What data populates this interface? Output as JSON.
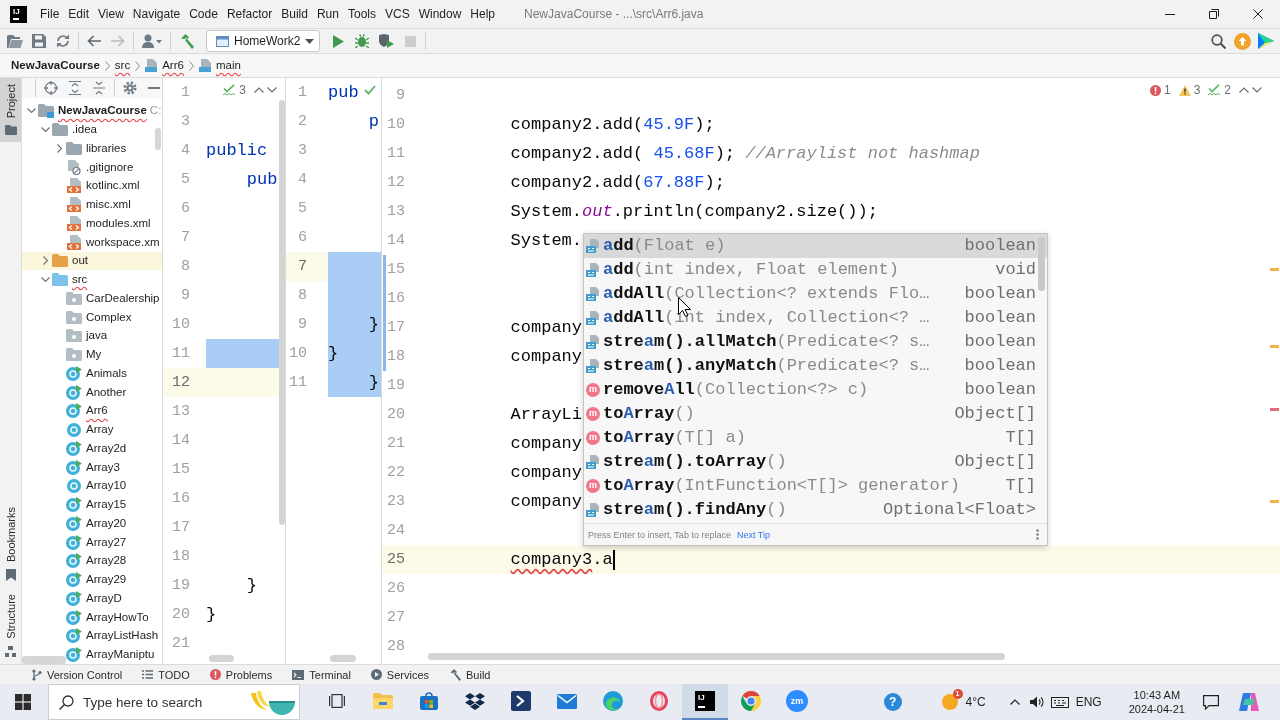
{
  "window": {
    "logo": "IJ",
    "menus": [
      "File",
      "Edit",
      "View",
      "Navigate",
      "Code",
      "Refactor",
      "Build",
      "Run",
      "Tools",
      "VCS",
      "Window",
      "Help"
    ],
    "title": "NewJavaCourse - ...\\src\\Arr6.java"
  },
  "toolbar": {
    "run_config": "HomeWork2",
    "stop_disabled": true
  },
  "breadcrumbs": [
    {
      "label": "NewJavaCourse",
      "kind": "project",
      "error": false
    },
    {
      "label": "src",
      "kind": "folder",
      "error": true
    },
    {
      "label": "Arr6",
      "kind": "class",
      "error": true
    },
    {
      "label": "main",
      "kind": "method",
      "error": true
    }
  ],
  "tool_strip": {
    "top": [
      {
        "label": "Project",
        "kind": "project",
        "selected": true
      }
    ],
    "bottom": [
      {
        "label": "Bookmarks",
        "kind": "bookmarks",
        "selected": false
      },
      {
        "label": "Structure",
        "kind": "structure",
        "selected": false
      }
    ]
  },
  "project_tree": [
    {
      "label": "NewJavaCourse",
      "kind": "project",
      "path": "C:",
      "error": true,
      "expanded": true,
      "children": [
        {
          "label": ".idea",
          "kind": "folder",
          "error": false,
          "expanded": true,
          "children": [
            {
              "label": "libraries",
              "kind": "folder",
              "error": false,
              "expanded": false
            },
            {
              "label": ".gitignore",
              "kind": "ignore-file",
              "error": false
            },
            {
              "label": "kotlinc.xml",
              "kind": "xml-file",
              "error": false
            },
            {
              "label": "misc.xml",
              "kind": "xml-file",
              "error": false
            },
            {
              "label": "modules.xml",
              "kind": "xml-file",
              "error": false
            },
            {
              "label": "workspace.xm",
              "kind": "xml-file",
              "error": false
            }
          ]
        },
        {
          "label": "out",
          "kind": "excluded-folder",
          "error": false,
          "expanded": false
        },
        {
          "label": "src",
          "kind": "source-folder",
          "error": true,
          "expanded": true,
          "children": [
            {
              "label": "CarDealership",
              "kind": "package",
              "error": false
            },
            {
              "label": "Complex",
              "kind": "package",
              "error": false
            },
            {
              "label": "java",
              "kind": "package",
              "error": false
            },
            {
              "label": "My",
              "kind": "package",
              "error": false
            },
            {
              "label": "Animals",
              "kind": "main-class",
              "error": false
            },
            {
              "label": "Another",
              "kind": "main-class",
              "error": false
            },
            {
              "label": "Arr6",
              "kind": "main-class",
              "error": true
            },
            {
              "label": "Array",
              "kind": "class",
              "error": false
            },
            {
              "label": "Array2d",
              "kind": "main-class",
              "error": false
            },
            {
              "label": "Array3",
              "kind": "main-class",
              "error": false
            },
            {
              "label": "Array10",
              "kind": "class",
              "error": false
            },
            {
              "label": "Array15",
              "kind": "main-class",
              "error": false
            },
            {
              "label": "Array20",
              "kind": "main-class",
              "error": false
            },
            {
              "label": "Array27",
              "kind": "main-class",
              "error": false
            },
            {
              "label": "Array28",
              "kind": "main-class",
              "error": false
            },
            {
              "label": "Array29",
              "kind": "main-class",
              "error": false
            },
            {
              "label": "ArrayD",
              "kind": "main-class",
              "error": false
            },
            {
              "label": "ArrayHowTo",
              "kind": "main-class",
              "error": false
            },
            {
              "label": "ArrayListHash",
              "kind": "main-class",
              "error": false
            },
            {
              "label": "ArrayManiptu",
              "kind": "main-class",
              "error": false
            }
          ]
        }
      ]
    }
  ],
  "editor_panes": [
    {
      "focused": false,
      "inspections": [
        {
          "kind": "typo",
          "count": "3"
        }
      ],
      "lines": [
        {
          "number": "1",
          "selected": false,
          "current": false
        },
        {
          "number": "3",
          "selected": false,
          "current": false
        },
        {
          "number": "4",
          "selected": false,
          "current": false,
          "tokens": [
            {
              "text": "public",
              "kind": "keyword"
            }
          ]
        },
        {
          "number": "5",
          "selected": false,
          "current": false,
          "tokens": [
            {
              "text": "    pub",
              "kind": "keyword"
            }
          ]
        },
        {
          "number": "6",
          "selected": false,
          "current": false
        },
        {
          "number": "7",
          "selected": false,
          "current": false
        },
        {
          "number": "8",
          "selected": false,
          "current": false
        },
        {
          "number": "9",
          "selected": false,
          "current": false
        },
        {
          "number": "10",
          "selected": false,
          "current": false
        },
        {
          "number": "11",
          "selected": true,
          "current": false
        },
        {
          "number": "12",
          "selected": false,
          "current": true
        },
        {
          "number": "13",
          "selected": false,
          "current": false
        },
        {
          "number": "14",
          "selected": false,
          "current": false
        },
        {
          "number": "15",
          "selected": false,
          "current": false
        },
        {
          "number": "16",
          "selected": false,
          "current": false
        },
        {
          "number": "17",
          "selected": false,
          "current": false
        },
        {
          "number": "18",
          "selected": false,
          "current": false
        },
        {
          "number": "19",
          "selected": false,
          "current": false,
          "tokens": [
            {
              "text": "    }",
              "kind": "plain"
            }
          ]
        },
        {
          "number": "20",
          "selected": false,
          "current": false,
          "tokens": [
            {
              "text": "}",
              "kind": "plain"
            }
          ]
        },
        {
          "number": "21",
          "selected": false,
          "current": false
        }
      ]
    },
    {
      "focused": false,
      "inspections": [
        {
          "kind": "ok"
        }
      ],
      "lines": [
        {
          "number": "1",
          "selected": false,
          "current": false,
          "tokens": [
            {
              "text": "pub",
              "kind": "keyword"
            }
          ]
        },
        {
          "number": "2",
          "selected": false,
          "current": false,
          "tokens": [
            {
              "text": "    p",
              "kind": "keyword"
            }
          ]
        },
        {
          "number": "3",
          "selected": false,
          "current": false
        },
        {
          "number": "4",
          "selected": false,
          "current": false
        },
        {
          "number": "5",
          "selected": false,
          "current": false
        },
        {
          "number": "6",
          "selected": false,
          "current": false
        },
        {
          "number": "7",
          "selected": true,
          "current": true
        },
        {
          "number": "8",
          "selected": true,
          "current": false
        },
        {
          "number": "9",
          "selected": true,
          "current": false,
          "tokens": [
            {
              "text": "    }",
              "kind": "plain"
            }
          ]
        },
        {
          "number": "10",
          "selected": true,
          "current": false,
          "tokens": [
            {
              "text": "}",
              "kind": "plain"
            }
          ]
        },
        {
          "number": "11",
          "selected": true,
          "current": false,
          "tokens": [
            {
              "text": "    }",
              "kind": "plain"
            }
          ]
        }
      ]
    },
    {
      "focused": true,
      "inspections": [
        {
          "kind": "error",
          "count": "1"
        },
        {
          "kind": "warning",
          "count": "3"
        },
        {
          "kind": "typo",
          "count": "2"
        }
      ],
      "error_stripe": [
        {
          "kind": "warning"
        },
        {
          "kind": "warning"
        },
        {
          "kind": "error"
        },
        {
          "kind": "warning"
        }
      ],
      "lines": [
        {
          "number": "9",
          "selected": false,
          "current": false,
          "changed": false
        },
        {
          "number": "10",
          "selected": false,
          "current": false,
          "changed": false,
          "tokens": [
            {
              "text": "        company2.add(",
              "kind": "plain"
            },
            {
              "text": "45.9F",
              "kind": "number"
            },
            {
              "text": ");",
              "kind": "plain"
            }
          ]
        },
        {
          "number": "11",
          "selected": false,
          "current": false,
          "changed": false,
          "tokens": [
            {
              "text": "        company2.add( ",
              "kind": "plain"
            },
            {
              "text": "45.68F",
              "kind": "number"
            },
            {
              "text": "); ",
              "kind": "plain"
            },
            {
              "text": "//Arraylist not hashmap",
              "kind": "comment"
            }
          ]
        },
        {
          "number": "12",
          "selected": false,
          "current": false,
          "changed": false,
          "tokens": [
            {
              "text": "        company2.add(",
              "kind": "plain"
            },
            {
              "text": "67.88F",
              "kind": "number"
            },
            {
              "text": ");",
              "kind": "plain"
            }
          ]
        },
        {
          "number": "13",
          "selected": false,
          "current": false,
          "changed": false,
          "tokens": [
            {
              "text": "        System.",
              "kind": "plain"
            },
            {
              "text": "out",
              "kind": "static"
            },
            {
              "text": ".println(company2.size());",
              "kind": "plain"
            }
          ]
        },
        {
          "number": "14",
          "selected": false,
          "current": false,
          "changed": false,
          "tokens": [
            {
              "text": "        System.",
              "kind": "plain"
            }
          ]
        },
        {
          "number": "15",
          "selected": false,
          "current": false,
          "changed": true
        },
        {
          "number": "16",
          "selected": false,
          "current": false,
          "changed": true
        },
        {
          "number": "17",
          "selected": false,
          "current": false,
          "changed": true,
          "tokens": [
            {
              "text": "        company",
              "kind": "plain"
            }
          ]
        },
        {
          "number": "18",
          "selected": false,
          "current": false,
          "changed": true,
          "tokens": [
            {
              "text": "        company",
              "kind": "plain"
            }
          ]
        },
        {
          "number": "19",
          "selected": false,
          "current": false,
          "changed": false
        },
        {
          "number": "20",
          "selected": false,
          "current": false,
          "changed": false,
          "tokens": [
            {
              "text": "        ArrayLi",
              "kind": "plain"
            }
          ]
        },
        {
          "number": "21",
          "selected": false,
          "current": false,
          "changed": false,
          "tokens": [
            {
              "text": "        company",
              "kind": "plain"
            }
          ]
        },
        {
          "number": "22",
          "selected": false,
          "current": false,
          "changed": false,
          "tokens": [
            {
              "text": "        company",
              "kind": "plain"
            }
          ]
        },
        {
          "number": "23",
          "selected": false,
          "current": false,
          "changed": false,
          "tokens": [
            {
              "text": "        company",
              "kind": "plain"
            }
          ]
        },
        {
          "number": "24",
          "selected": false,
          "current": false,
          "changed": false
        },
        {
          "number": "25",
          "selected": false,
          "current": true,
          "changed": false,
          "tokens": [
            {
              "text": "        company3",
              "kind": "error"
            },
            {
              "text": ".a",
              "kind": "plain"
            }
          ]
        },
        {
          "number": "26",
          "selected": false,
          "current": false,
          "changed": false
        },
        {
          "number": "27",
          "selected": false,
          "current": false,
          "changed": false
        },
        {
          "number": "28",
          "selected": false,
          "current": false,
          "changed": false
        }
      ]
    }
  ],
  "completion": {
    "items": [
      {
        "kind": "chain",
        "selected": true,
        "name_parts": [
          {
            "text": "a",
            "match": true
          },
          {
            "text": "dd",
            "match": false
          }
        ],
        "params": "(Float e)",
        "type": "boolean"
      },
      {
        "kind": "chain",
        "selected": false,
        "name_parts": [
          {
            "text": "a",
            "match": true
          },
          {
            "text": "dd",
            "match": false
          }
        ],
        "params": "(int index, Float element)",
        "type": "void"
      },
      {
        "kind": "chain",
        "selected": false,
        "name_parts": [
          {
            "text": "a",
            "match": true
          },
          {
            "text": "ddAll",
            "match": false
          }
        ],
        "params": "(Collection<? extends Flo…",
        "type": "boolean"
      },
      {
        "kind": "chain",
        "selected": false,
        "name_parts": [
          {
            "text": "a",
            "match": true
          },
          {
            "text": "ddAll",
            "match": false
          }
        ],
        "params": "(int index, Collection<? …",
        "type": "boolean"
      },
      {
        "kind": "chain",
        "selected": false,
        "name_parts": [
          {
            "text": "stre",
            "match": false
          },
          {
            "text": "a",
            "match": true
          },
          {
            "text": "m().allMatch",
            "match": false
          }
        ],
        "params": "(Predicate<? s…",
        "type": "boolean"
      },
      {
        "kind": "chain",
        "selected": false,
        "name_parts": [
          {
            "text": "stre",
            "match": false
          },
          {
            "text": "a",
            "match": true
          },
          {
            "text": "m().anyMatch",
            "match": false
          }
        ],
        "params": "(Predicate<? s…",
        "type": "boolean"
      },
      {
        "kind": "method",
        "badge": "m",
        "selected": false,
        "name_parts": [
          {
            "text": "remove",
            "match": false
          },
          {
            "text": "A",
            "match": true
          },
          {
            "text": "ll",
            "match": false
          }
        ],
        "params": "(Collection<?> c)",
        "type": "boolean"
      },
      {
        "kind": "method",
        "badge": "m",
        "selected": false,
        "name_parts": [
          {
            "text": "to",
            "match": false
          },
          {
            "text": "A",
            "match": true
          },
          {
            "text": "rray",
            "match": false
          }
        ],
        "params": "()",
        "type": "Object[]"
      },
      {
        "kind": "method",
        "badge": "m",
        "selected": false,
        "name_parts": [
          {
            "text": "to",
            "match": false
          },
          {
            "text": "A",
            "match": true
          },
          {
            "text": "rray",
            "match": false
          }
        ],
        "params": "(T[] a)",
        "type": "T[]"
      },
      {
        "kind": "chain",
        "selected": false,
        "name_parts": [
          {
            "text": "stre",
            "match": false
          },
          {
            "text": "a",
            "match": true
          },
          {
            "text": "m().toArray",
            "match": false
          }
        ],
        "params": "()",
        "type": "Object[]"
      },
      {
        "kind": "method",
        "badge": "m",
        "selected": false,
        "name_parts": [
          {
            "text": "to",
            "match": false
          },
          {
            "text": "A",
            "match": true
          },
          {
            "text": "rray",
            "match": false
          }
        ],
        "params": "(IntFunction<T[]> generator)",
        "type": "T[]"
      },
      {
        "kind": "chain",
        "selected": false,
        "name_parts": [
          {
            "text": "stre",
            "match": false
          },
          {
            "text": "a",
            "match": true
          },
          {
            "text": "m().findAny",
            "match": false
          }
        ],
        "params": "()",
        "type": "Optional<Float>"
      }
    ],
    "hint": "Press Enter to insert, Tab to replace",
    "tip_link": "Next Tip"
  },
  "tool_windows": [
    {
      "label": "Version Control",
      "kind": "vcs"
    },
    {
      "label": "TODO",
      "kind": "todo"
    },
    {
      "label": "Problems",
      "kind": "problems"
    },
    {
      "label": "Terminal",
      "kind": "terminal"
    },
    {
      "label": "Services",
      "kind": "services"
    },
    {
      "label": "Build",
      "kind": "build"
    }
  ],
  "taskbar": {
    "search_placeholder": "Type here to search",
    "apps": [
      {
        "kind": "task-view",
        "selected": false
      },
      {
        "kind": "explorer",
        "selected": false
      },
      {
        "kind": "store",
        "selected": false
      },
      {
        "kind": "dropbox",
        "selected": false
      },
      {
        "kind": "console",
        "selected": false
      },
      {
        "kind": "mail",
        "selected": false
      },
      {
        "kind": "edge",
        "selected": false
      },
      {
        "kind": "opera",
        "selected": false
      },
      {
        "kind": "ide",
        "logo": "IJ",
        "selected": true
      },
      {
        "kind": "chrome",
        "selected": false
      },
      {
        "kind": "zoom",
        "logo": "zm",
        "selected": false
      }
    ],
    "tray": {
      "help": "?",
      "weather_badge": "1",
      "temperature": "4°C",
      "language": "ENG",
      "time": "10:43 AM",
      "date": "2024-04-21"
    }
  }
}
